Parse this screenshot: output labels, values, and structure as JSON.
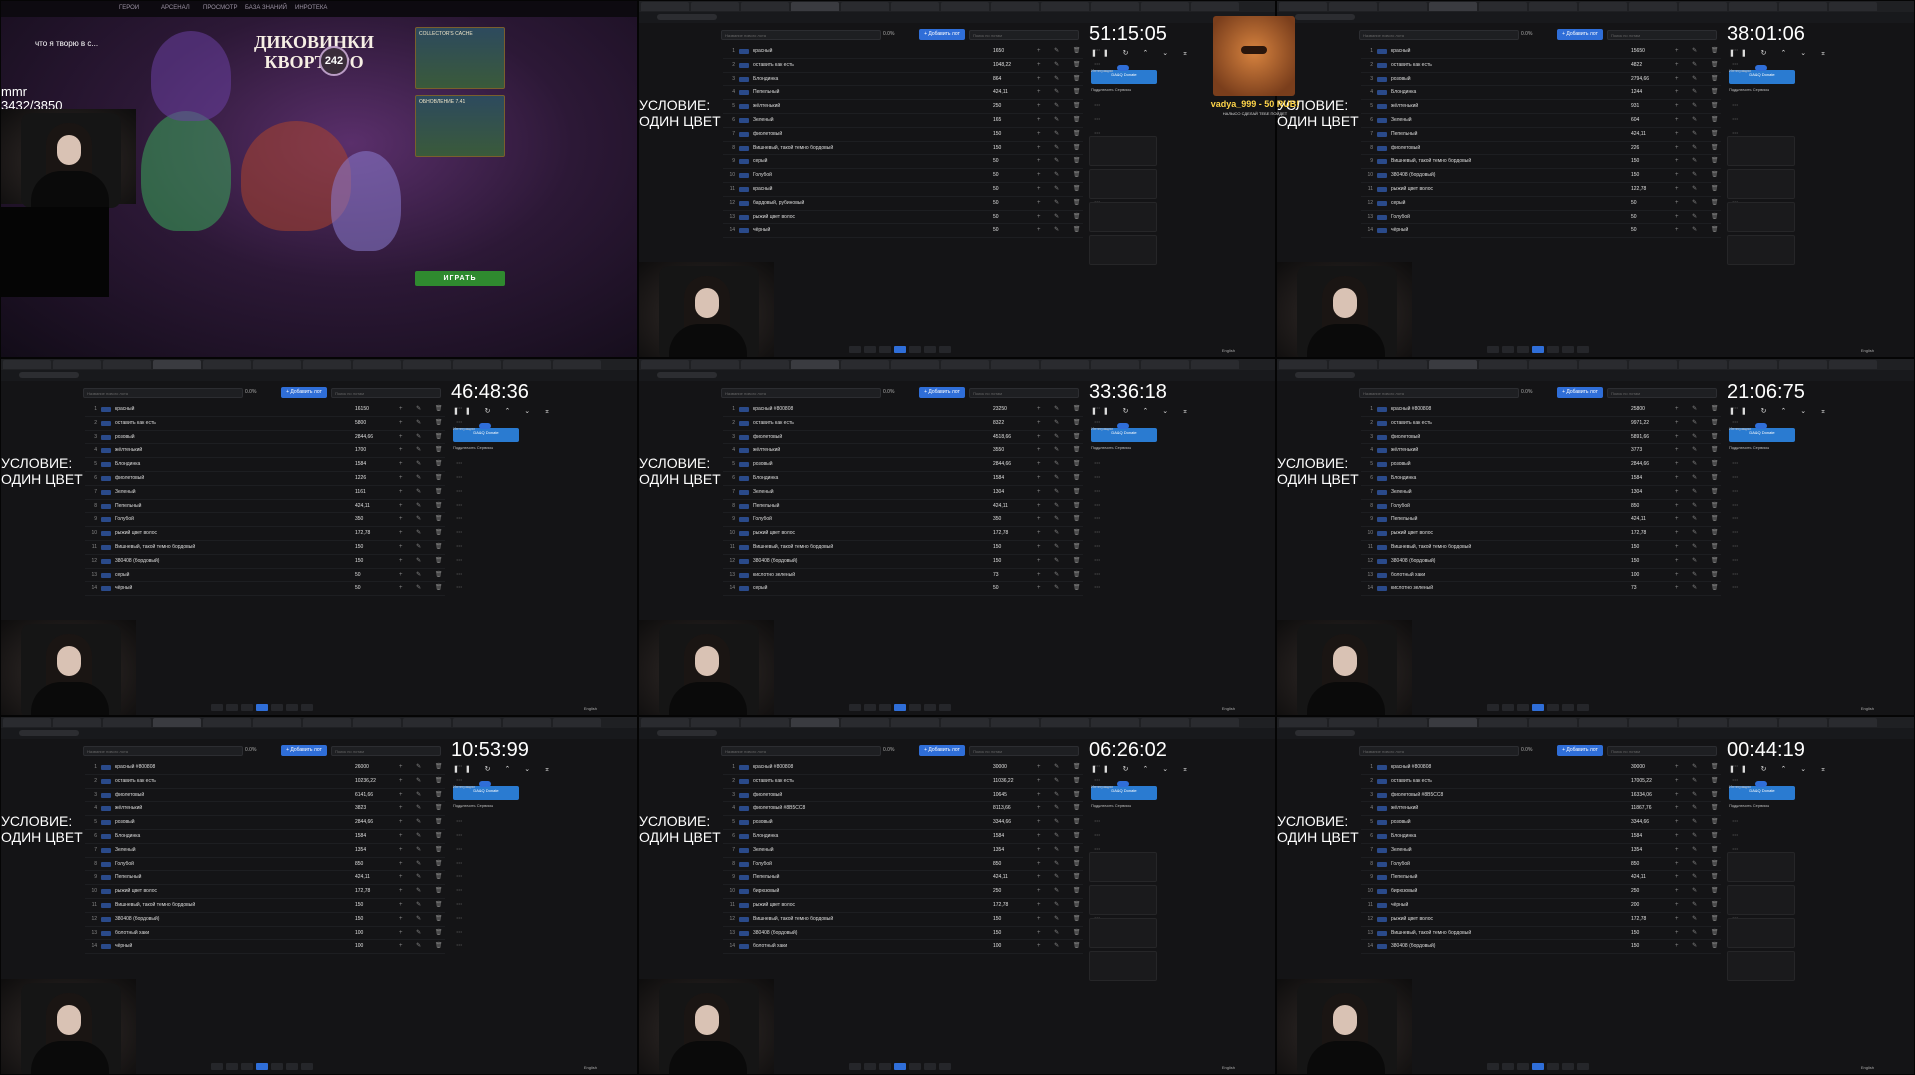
{
  "game": {
    "nav": [
      "ГЕРОИ",
      "АРСЕНАЛ",
      "ПРОСМОТР",
      "БАЗА ЗНАНИЙ",
      "ИНРОТЕКА"
    ],
    "title_line1": "ДИКОВИНКИ",
    "title_line2": "КВОРТЕРО",
    "level": "242",
    "stream_title": "что я творю в с...",
    "mmr_label": "mmr",
    "mmr_value": "3432/3850",
    "card1": "COLLECTOR'S CACHE",
    "card2": "ОБНОВЛЕНИЕ 7.41",
    "play": "ИГРАТЬ"
  },
  "panels": [
    {
      "timer": "51:15:05",
      "condition": [
        "УСЛОВИЕ:",
        "ОДИН ЦВЕТ"
      ],
      "lots": [
        {
          "n": "1",
          "name": "красный",
          "pct": "",
          "amount": "1650"
        },
        {
          "n": "2",
          "name": "оставить как есть",
          "pct": "",
          "amount": "1048,22"
        },
        {
          "n": "3",
          "name": "Блондинка",
          "pct": "",
          "amount": "864"
        },
        {
          "n": "4",
          "name": "Пепельный",
          "pct": "",
          "amount": "424,11"
        },
        {
          "n": "5",
          "name": "жёлтенький",
          "pct": "",
          "amount": "250"
        },
        {
          "n": "6",
          "name": "Зеленый",
          "pct": "",
          "amount": "165"
        },
        {
          "n": "7",
          "name": "фиолетовый",
          "pct": "",
          "amount": "150"
        },
        {
          "n": "8",
          "name": "Вишневый, такой темно бордовый",
          "pct": "",
          "amount": "150"
        },
        {
          "n": "9",
          "name": "серый",
          "pct": "",
          "amount": "50"
        },
        {
          "n": "10",
          "name": "Голубой",
          "pct": "",
          "amount": "50"
        },
        {
          "n": "11",
          "name": "красный",
          "pct": "",
          "amount": "50"
        },
        {
          "n": "12",
          "name": "бардовый, рубиновый",
          "pct": "",
          "amount": "50"
        },
        {
          "n": "13",
          "name": "рыжий цвет волос",
          "pct": "",
          "amount": "50"
        },
        {
          "n": "14",
          "name": "чёрный",
          "pct": "",
          "amount": "50"
        }
      ]
    },
    {
      "timer": "38:01:06",
      "condition": [
        "УСЛОВИЕ:",
        "ОДИН ЦВЕТ"
      ],
      "lots": [
        {
          "n": "1",
          "name": "красный",
          "pct": "",
          "amount": "15650"
        },
        {
          "n": "2",
          "name": "оставить как есть",
          "pct": "",
          "amount": "4822"
        },
        {
          "n": "3",
          "name": "розовый",
          "pct": "",
          "amount": "2794,66"
        },
        {
          "n": "4",
          "name": "Блондинка",
          "pct": "",
          "amount": "1244"
        },
        {
          "n": "5",
          "name": "жёлтенький",
          "pct": "",
          "amount": "931"
        },
        {
          "n": "6",
          "name": "Зеленый",
          "pct": "",
          "amount": "604"
        },
        {
          "n": "7",
          "name": "Пепельный",
          "pct": "",
          "amount": "424,11"
        },
        {
          "n": "8",
          "name": "фиолетовый",
          "pct": "",
          "amount": "226"
        },
        {
          "n": "9",
          "name": "Вишневый, такой темно бордовый",
          "pct": "",
          "amount": "150"
        },
        {
          "n": "10",
          "name": "380408 (бордовый)",
          "pct": "",
          "amount": "150"
        },
        {
          "n": "11",
          "name": "рыжий цвет волос",
          "pct": "",
          "amount": "122,78"
        },
        {
          "n": "12",
          "name": "серый",
          "pct": "",
          "amount": "50"
        },
        {
          "n": "13",
          "name": "Голубой",
          "pct": "",
          "amount": "50"
        },
        {
          "n": "14",
          "name": "чёрный",
          "pct": "",
          "amount": "50"
        }
      ],
      "popup_name": "vadya_999 - 50 RUB!",
      "popup_msg": "НАЛЫСО СДЕЛАЙ ТЕБЕ ПОЙДЕТ"
    },
    {
      "timer": "46:48:36",
      "condition": [
        "УСЛОВИЕ:",
        "ОДИН ЦВЕТ"
      ],
      "lots": [
        {
          "n": "1",
          "name": "красный",
          "pct": "",
          "amount": "16150"
        },
        {
          "n": "2",
          "name": "оставить как есть",
          "pct": "",
          "amount": "5800"
        },
        {
          "n": "3",
          "name": "розовый",
          "pct": "",
          "amount": "2844,66"
        },
        {
          "n": "4",
          "name": "жёлтенький",
          "pct": "",
          "amount": "1700"
        },
        {
          "n": "5",
          "name": "Блондинка",
          "pct": "",
          "amount": "1584"
        },
        {
          "n": "6",
          "name": "фиолетовый",
          "pct": "",
          "amount": "1226"
        },
        {
          "n": "7",
          "name": "Зеленый",
          "pct": "",
          "amount": "1161"
        },
        {
          "n": "8",
          "name": "Пепельный",
          "pct": "",
          "amount": "424,11"
        },
        {
          "n": "9",
          "name": "Голубой",
          "pct": "",
          "amount": "350"
        },
        {
          "n": "10",
          "name": "рыжий цвет волос",
          "pct": "",
          "amount": "172,78"
        },
        {
          "n": "11",
          "name": "Вишневый, такой темно бордовый",
          "pct": "",
          "amount": "150"
        },
        {
          "n": "12",
          "name": "380408 (бордовый)",
          "pct": "",
          "amount": "150"
        },
        {
          "n": "13",
          "name": "серый",
          "pct": "",
          "amount": "50"
        },
        {
          "n": "14",
          "name": "чёрный",
          "pct": "",
          "amount": "50"
        }
      ]
    },
    {
      "timer": "33:36:18",
      "condition": [
        "УСЛОВИЕ:",
        "ОДИН ЦВЕТ"
      ],
      "lots": [
        {
          "n": "1",
          "name": "красный #800808",
          "pct": "",
          "amount": "23250"
        },
        {
          "n": "2",
          "name": "оставить как есть",
          "pct": "",
          "amount": "8322"
        },
        {
          "n": "3",
          "name": "фиолетовый",
          "pct": "",
          "amount": "4518,66"
        },
        {
          "n": "4",
          "name": "жёлтенький",
          "pct": "",
          "amount": "3550"
        },
        {
          "n": "5",
          "name": "розовый",
          "pct": "",
          "amount": "2844,66"
        },
        {
          "n": "6",
          "name": "Блондинка",
          "pct": "",
          "amount": "1584"
        },
        {
          "n": "7",
          "name": "Зеленый",
          "pct": "",
          "amount": "1304"
        },
        {
          "n": "8",
          "name": "Пепельный",
          "pct": "",
          "amount": "424,11"
        },
        {
          "n": "9",
          "name": "Голубой",
          "pct": "",
          "amount": "350"
        },
        {
          "n": "10",
          "name": "рыжий цвет волос",
          "pct": "",
          "amount": "172,78"
        },
        {
          "n": "11",
          "name": "Вишневый, такой темно бордовый",
          "pct": "",
          "amount": "150"
        },
        {
          "n": "12",
          "name": "380408 (бордовый)",
          "pct": "",
          "amount": "150"
        },
        {
          "n": "13",
          "name": "кислотно зеленый",
          "pct": "",
          "amount": "73"
        },
        {
          "n": "14",
          "name": "серый",
          "pct": "",
          "amount": "50"
        }
      ]
    },
    {
      "timer": "21:06:75",
      "condition": [
        "УСЛОВИЕ:",
        "ОДИН ЦВЕТ"
      ],
      "lots": [
        {
          "n": "1",
          "name": "красный #800808",
          "pct": "",
          "amount": "25800"
        },
        {
          "n": "2",
          "name": "оставить как есть",
          "pct": "",
          "amount": "9971,22"
        },
        {
          "n": "3",
          "name": "фиолетовый",
          "pct": "",
          "amount": "5891,66"
        },
        {
          "n": "4",
          "name": "жёлтенький",
          "pct": "",
          "amount": "3773"
        },
        {
          "n": "5",
          "name": "розовый",
          "pct": "",
          "amount": "2844,66"
        },
        {
          "n": "6",
          "name": "Блондинка",
          "pct": "",
          "amount": "1584"
        },
        {
          "n": "7",
          "name": "Зеленый",
          "pct": "",
          "amount": "1304"
        },
        {
          "n": "8",
          "name": "Голубой",
          "pct": "",
          "amount": "850"
        },
        {
          "n": "9",
          "name": "Пепельный",
          "pct": "",
          "amount": "424,11"
        },
        {
          "n": "10",
          "name": "рыжий цвет волос",
          "pct": "",
          "amount": "172,78"
        },
        {
          "n": "11",
          "name": "Вишневый, такой темно бордовый",
          "pct": "",
          "amount": "150"
        },
        {
          "n": "12",
          "name": "380408 (бордовый)",
          "pct": "",
          "amount": "150"
        },
        {
          "n": "13",
          "name": "болотный хаки",
          "pct": "",
          "amount": "100"
        },
        {
          "n": "14",
          "name": "кислотно зеленый",
          "pct": "",
          "amount": "73"
        }
      ]
    },
    {
      "timer": "10:53:99",
      "condition": [
        "УСЛОВИЕ:",
        "ОДИН ЦВЕТ"
      ],
      "lots": [
        {
          "n": "1",
          "name": "красный #800808",
          "pct": "",
          "amount": "26000"
        },
        {
          "n": "2",
          "name": "оставить как есть",
          "pct": "",
          "amount": "10236,22"
        },
        {
          "n": "3",
          "name": "фиолетовый",
          "pct": "",
          "amount": "6141,66"
        },
        {
          "n": "4",
          "name": "жёлтенький",
          "pct": "",
          "amount": "3823"
        },
        {
          "n": "5",
          "name": "розовый",
          "pct": "",
          "amount": "2844,66"
        },
        {
          "n": "6",
          "name": "Блондинка",
          "pct": "",
          "amount": "1584"
        },
        {
          "n": "7",
          "name": "Зеленый",
          "pct": "",
          "amount": "1354"
        },
        {
          "n": "8",
          "name": "Голубой",
          "pct": "",
          "amount": "850"
        },
        {
          "n": "9",
          "name": "Пепельный",
          "pct": "",
          "amount": "424,11"
        },
        {
          "n": "10",
          "name": "рыжий цвет волос",
          "pct": "",
          "amount": "172,78"
        },
        {
          "n": "11",
          "name": "Вишневый, такой темно бордовый",
          "pct": "",
          "amount": "150"
        },
        {
          "n": "12",
          "name": "380408 (бордовый)",
          "pct": "",
          "amount": "150"
        },
        {
          "n": "13",
          "name": "болотный хаки",
          "pct": "",
          "amount": "100"
        },
        {
          "n": "14",
          "name": "чёрный",
          "pct": "",
          "amount": "100"
        }
      ]
    },
    {
      "timer": "06:26:02",
      "condition": [
        "УСЛОВИЕ:",
        "ОДИН ЦВЕТ"
      ],
      "lots": [
        {
          "n": "1",
          "name": "красный #800808",
          "pct": "",
          "amount": "30000"
        },
        {
          "n": "2",
          "name": "оставить как есть",
          "pct": "",
          "amount": "11036,22"
        },
        {
          "n": "3",
          "name": "фиолетовый",
          "pct": "",
          "amount": "10645"
        },
        {
          "n": "4",
          "name": "фиолетовый #8B5CC8",
          "pct": "",
          "amount": "8113,66"
        },
        {
          "n": "5",
          "name": "розовый",
          "pct": "",
          "amount": "3344,66"
        },
        {
          "n": "6",
          "name": "Блондинка",
          "pct": "",
          "amount": "1584"
        },
        {
          "n": "7",
          "name": "Зеленый",
          "pct": "",
          "amount": "1354"
        },
        {
          "n": "8",
          "name": "Голубой",
          "pct": "",
          "amount": "850"
        },
        {
          "n": "9",
          "name": "Пепельный",
          "pct": "",
          "amount": "424,11"
        },
        {
          "n": "10",
          "name": "бирюзовый",
          "pct": "",
          "amount": "250"
        },
        {
          "n": "11",
          "name": "рыжий цвет волос",
          "pct": "",
          "amount": "172,78"
        },
        {
          "n": "12",
          "name": "Вишневый, такой темно бордовый",
          "pct": "",
          "amount": "150"
        },
        {
          "n": "13",
          "name": "380408 (бордовый)",
          "pct": "",
          "amount": "150"
        },
        {
          "n": "14",
          "name": "болотный хаки",
          "pct": "",
          "amount": "100"
        }
      ]
    },
    {
      "timer": "00:44:19",
      "condition": [
        "УСЛОВИЕ:",
        "ОДИН ЦВЕТ"
      ],
      "lots": [
        {
          "n": "1",
          "name": "красный #800808",
          "pct": "",
          "amount": "30000"
        },
        {
          "n": "2",
          "name": "оставить как есть",
          "pct": "",
          "amount": "17005,22"
        },
        {
          "n": "3",
          "name": "фиолетовый #8B5CC8",
          "pct": "",
          "amount": "16334,06"
        },
        {
          "n": "4",
          "name": "жёлтенький",
          "pct": "",
          "amount": "11867,76"
        },
        {
          "n": "5",
          "name": "розовый",
          "pct": "",
          "amount": "3344,66"
        },
        {
          "n": "6",
          "name": "Блондинка",
          "pct": "",
          "amount": "1584"
        },
        {
          "n": "7",
          "name": "Зеленый",
          "pct": "",
          "amount": "1354"
        },
        {
          "n": "8",
          "name": "Голубой",
          "pct": "",
          "amount": "850"
        },
        {
          "n": "9",
          "name": "Пепельный",
          "pct": "",
          "amount": "424,11"
        },
        {
          "n": "10",
          "name": "бирюзовый",
          "pct": "",
          "amount": "250"
        },
        {
          "n": "11",
          "name": "чёрный",
          "pct": "",
          "amount": "200"
        },
        {
          "n": "12",
          "name": "рыжий цвет волос",
          "pct": "",
          "amount": "172,78"
        },
        {
          "n": "13",
          "name": "Вишневый, такой темно бордовый",
          "pct": "",
          "amount": "150"
        },
        {
          "n": "14",
          "name": "380408 (бордовый)",
          "pct": "",
          "amount": "150"
        }
      ]
    }
  ],
  "toolbar": {
    "placeholder": "Название нового лота",
    "pct": "0.0%",
    "add_label": "+ Добавить лот",
    "search_placeholder": "Поиск по лотам"
  },
  "integration": {
    "label": "Интеграции",
    "da_label": "DA&Q Donate",
    "connect_label": "Подключить Сервисы"
  },
  "lang": "English"
}
